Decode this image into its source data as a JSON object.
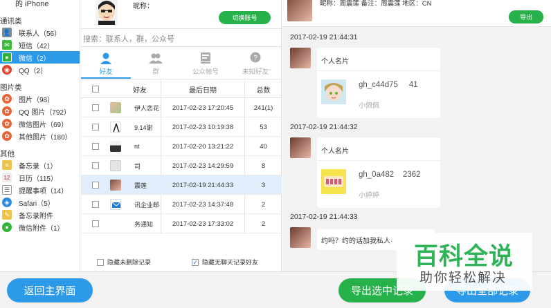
{
  "sidebar": {
    "device_title": "的 iPhone",
    "categories": {
      "comm": "通讯类",
      "images": "图片类",
      "other": "其他"
    },
    "items": [
      {
        "label": "联系人（56）",
        "icon": "contacts-icon",
        "color": "#7a8b99"
      },
      {
        "label": "短信（42）",
        "icon": "sms-icon",
        "color": "#3dbb3d"
      },
      {
        "label": "微信（2）",
        "icon": "wechat-icon",
        "color": "#2fb437"
      },
      {
        "label": "QQ（2）",
        "icon": "qq-icon",
        "color": "#e0432f"
      },
      {
        "label": "图片（98）",
        "icon": "photos-icon",
        "color": "#e8653a"
      },
      {
        "label": "QQ 图片（792）",
        "icon": "qq-photos-icon",
        "color": "#e8653a"
      },
      {
        "label": "微信图片（69）",
        "icon": "wechat-photos-icon",
        "color": "#e8653a"
      },
      {
        "label": "其他图片（180）",
        "icon": "other-photos-icon",
        "color": "#e8653a"
      },
      {
        "label": "备忘录（1）",
        "icon": "notes-icon",
        "color": "#f0c34a"
      },
      {
        "label": "日历（115）",
        "icon": "calendar-icon",
        "color": "#d9d9d9"
      },
      {
        "label": "提醒事项（14）",
        "icon": "reminders-icon",
        "color": "#8a8a8a"
      },
      {
        "label": "Safari（5）",
        "icon": "safari-icon",
        "color": "#2c8de0"
      },
      {
        "label": "备忘录附件",
        "icon": "notes-attachment-icon",
        "color": "#f0c34a"
      },
      {
        "label": "微信附件（1）",
        "icon": "wechat-attachment-icon",
        "color": "#2fb437"
      }
    ]
  },
  "profile": {
    "nickname_label": "昵称：",
    "switch_button": "切换账号"
  },
  "search": {
    "placeholder": "搜索：联系人，群，公众号"
  },
  "tabs": [
    {
      "label": "好友",
      "icon": "friend-icon"
    },
    {
      "label": "群",
      "icon": "group-icon"
    },
    {
      "label": "公众帐号",
      "icon": "official-account-icon"
    },
    {
      "label": "未知好友",
      "icon": "unknown-friend-icon"
    }
  ],
  "table": {
    "headers": {
      "name": "好友",
      "date": "最后日期",
      "total": "总数"
    },
    "rows": [
      {
        "name": "伊人恋花",
        "date": "2017-02-23 17:20:45",
        "total": "241(1)",
        "selected": false
      },
      {
        "name": "9.14谢",
        "date": "2017-02-23 10:19:38",
        "total": "53",
        "selected": false
      },
      {
        "name": "nt",
        "date": "2017-02-20 13:21:22",
        "total": "40",
        "selected": false
      },
      {
        "name": "司",
        "date": "2017-02-23 14:29:59",
        "total": "8",
        "selected": false
      },
      {
        "name": "震莲",
        "date": "2017-02-19 21:44:33",
        "total": "3",
        "selected": true
      },
      {
        "name": "讯企业邮",
        "date": "2017-02-23 14:37:48",
        "total": "2",
        "selected": false
      },
      {
        "name": "务通知",
        "date": "2017-02-23 17:33:02",
        "total": "2",
        "selected": false
      }
    ]
  },
  "options": {
    "hide_deleted": "隐藏未删除记录",
    "hide_empty": "隐藏无聊天记录好友"
  },
  "chat": {
    "header_info": "昵称：周震莲    备注：周震莲        地区：CN",
    "export_button": "导出",
    "messages": [
      {
        "time": "2017-02-19 21:44:31",
        "type": "card",
        "title": "个人名片",
        "name": "gh_c44d75     41",
        "sub": "小佩佩"
      },
      {
        "time": "2017-02-19 21:44:32",
        "type": "card",
        "title": "个人名片",
        "name": "gh_0a482    2362",
        "sub": "小婷婷"
      },
      {
        "time": "2017-02-19 21:44:33",
        "type": "text",
        "text": "约吗？约的话加我私人·"
      }
    ]
  },
  "footer": {
    "back_button": "返回主界面",
    "export_selected": "导出选中记录",
    "export_all": "导出全部记录"
  },
  "watermark": {
    "main": "百科全说",
    "sub": "助你轻松解决"
  },
  "colors": {
    "accent": "#2c9ae8",
    "green": "#27b14a",
    "selected_row": "#dfeefa"
  }
}
